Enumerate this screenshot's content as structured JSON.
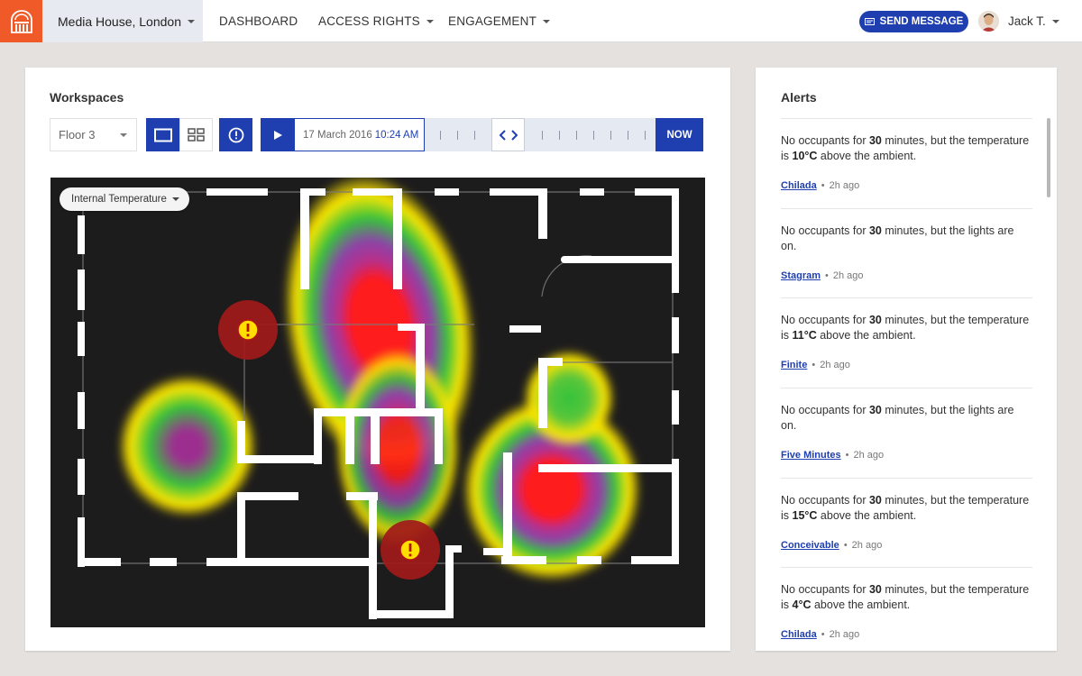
{
  "nav": {
    "location": "Media House, London",
    "dashboard": "DASHBOARD",
    "access_rights": "ACCESS RIGHTS",
    "engagement": "ENGAGEMENT",
    "send_message": "SEND MESSAGE",
    "user": "Jack T."
  },
  "workspaces": {
    "title": "Workspaces",
    "floor": "Floor 3",
    "date": "17 March 2016",
    "time": "10:24 AM",
    "now_label": "NOW",
    "metric": "Internal Temperature"
  },
  "alerts": {
    "title": "Alerts",
    "items": [
      {
        "pre": "No occupants for ",
        "minutes": "30",
        "mid": " minutes, but the temperature is ",
        "temp": "10°C",
        "post": "  above the ambient.",
        "source": "Chilada",
        "time": "2h ago"
      },
      {
        "pre": "No occupants for ",
        "minutes": "30",
        "mid": " minutes, but the lights are on.",
        "temp": "",
        "post": "",
        "source": "Stagram",
        "time": "2h ago"
      },
      {
        "pre": "No occupants for ",
        "minutes": "30",
        "mid": " minutes, but the temperature is ",
        "temp": "11°C",
        "post": "  above the ambient.",
        "source": "Finite",
        "time": "2h ago"
      },
      {
        "pre": "No occupants for ",
        "minutes": "30",
        "mid": " minutes, but the lights are on.",
        "temp": "",
        "post": "",
        "source": "Five Minutes",
        "time": "2h ago"
      },
      {
        "pre": "No occupants for ",
        "minutes": "30",
        "mid": " minutes, but the temperature is ",
        "temp": "15°C",
        "post": "  above the ambient.",
        "source": "Conceivable",
        "time": "2h ago"
      },
      {
        "pre": "No occupants for ",
        "minutes": "30",
        "mid": " minutes, but the temperature is ",
        "temp": "4°C",
        "post": "  above the ambient.",
        "source": "Chilada",
        "time": "2h ago"
      }
    ]
  },
  "colors": {
    "accent": "#1f3fb0",
    "brand": "#f05a28",
    "heat_hot": "#ff1a1a",
    "heat_warm": "#ffe600",
    "heat_mid": "#34c23a",
    "heat_core": "#9b2f8f"
  },
  "icons": [
    "building-logo-icon",
    "envelope-icon",
    "single-view-icon",
    "grid-view-icon",
    "alert-circle-icon",
    "play-icon",
    "scrub-handle-icon",
    "warning-marker-icon"
  ]
}
